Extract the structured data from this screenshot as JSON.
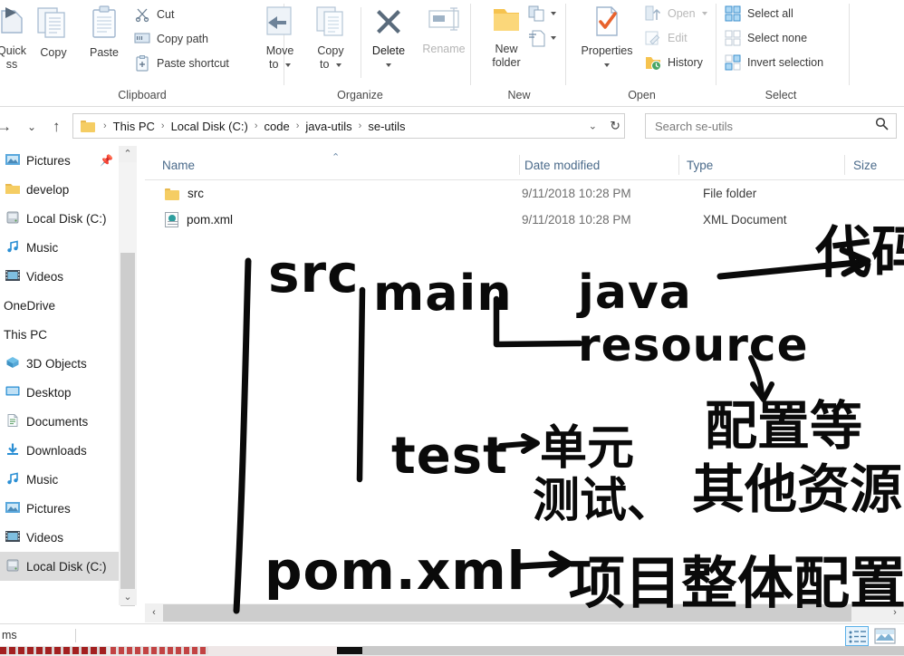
{
  "ribbon": {
    "groups": [
      {
        "label": "Clipboard"
      },
      {
        "label": "Organize"
      },
      {
        "label": "New"
      },
      {
        "label": "Open"
      },
      {
        "label": "Select"
      }
    ],
    "clipboard": {
      "pin_label_line1": "Quick",
      "pin_label_line2": "ss",
      "copy_label": "Copy",
      "paste_label": "Paste",
      "cut_label": "Cut",
      "copy_path_label": "Copy path",
      "paste_shortcut_label": "Paste shortcut"
    },
    "organize": {
      "move_to_line1": "Move",
      "move_to_line2": "to",
      "copy_to_line1": "Copy",
      "copy_to_line2": "to",
      "delete_label": "Delete",
      "rename_label": "Rename"
    },
    "new": {
      "new_folder_line1": "New",
      "new_folder_line2": "folder"
    },
    "open": {
      "properties_label": "Properties",
      "open_label": "Open",
      "edit_label": "Edit",
      "history_label": "History"
    },
    "select": {
      "select_all_label": "Select all",
      "select_none_label": "Select none",
      "invert_selection_label": "Invert selection"
    }
  },
  "addressbar": {
    "breadcrumbs": [
      "This PC",
      "Local Disk (C:)",
      "code",
      "java-utils",
      "se-utils"
    ],
    "separator": "›",
    "up_icon": "↑",
    "forward_icon": "→",
    "recent_icon": "⌄",
    "refresh_icon": "↻",
    "dropdown_icon": "⌄"
  },
  "search": {
    "placeholder": "Search se-utils",
    "value": "",
    "icon": "search-icon"
  },
  "sidebar": {
    "items": [
      {
        "label": "Pictures",
        "icon": "pictures-icon",
        "pinned": true,
        "indent": 1,
        "selected": false
      },
      {
        "label": "develop",
        "icon": "folder-icon",
        "pinned": false,
        "indent": 1,
        "selected": false
      },
      {
        "label": "Local Disk (C:)",
        "icon": "drive-icon",
        "pinned": false,
        "indent": 1,
        "selected": false
      },
      {
        "label": "Music",
        "icon": "music-icon",
        "pinned": false,
        "indent": 1,
        "selected": false
      },
      {
        "label": "Videos",
        "icon": "videos-icon",
        "pinned": false,
        "indent": 1,
        "selected": false
      },
      {
        "label": "OneDrive",
        "icon": "onedrive-icon",
        "pinned": false,
        "indent": 0,
        "selected": false
      },
      {
        "label": "This PC",
        "icon": "pc-icon",
        "pinned": false,
        "indent": 0,
        "selected": false
      },
      {
        "label": "3D Objects",
        "icon": "objects3d-icon",
        "pinned": false,
        "indent": 1,
        "selected": false
      },
      {
        "label": "Desktop",
        "icon": "desktop-icon",
        "pinned": false,
        "indent": 1,
        "selected": false
      },
      {
        "label": "Documents",
        "icon": "documents-icon",
        "pinned": false,
        "indent": 1,
        "selected": false
      },
      {
        "label": "Downloads",
        "icon": "downloads-icon",
        "pinned": false,
        "indent": 1,
        "selected": false
      },
      {
        "label": "Music",
        "icon": "music-icon",
        "pinned": false,
        "indent": 1,
        "selected": false
      },
      {
        "label": "Pictures",
        "icon": "pictures-icon",
        "pinned": false,
        "indent": 1,
        "selected": false
      },
      {
        "label": "Videos",
        "icon": "videos-icon",
        "pinned": false,
        "indent": 1,
        "selected": false
      },
      {
        "label": "Local Disk (C:)",
        "icon": "drive-icon",
        "pinned": false,
        "indent": 1,
        "selected": true
      }
    ]
  },
  "filelist": {
    "columns": [
      {
        "label": "Name",
        "sorted": "asc"
      },
      {
        "label": "Date modified",
        "sorted": ""
      },
      {
        "label": "Type",
        "sorted": ""
      },
      {
        "label": "Size",
        "sorted": ""
      }
    ],
    "sort_indicator": "⌃",
    "rows": [
      {
        "name": "src",
        "icon": "folder-icon",
        "date": "9/11/2018 10:28 PM",
        "type": "File folder",
        "size": ""
      },
      {
        "name": "pom.xml",
        "icon": "xml-file-icon",
        "date": "9/11/2018 10:28 PM",
        "type": "XML Document",
        "size": ""
      }
    ]
  },
  "statusbar": {
    "text": "ms",
    "view_details_icon": "details-view-icon",
    "view_large_icons_icon": "large-icons-view-icon"
  },
  "scrollbars": {
    "h_left_icon": "‹",
    "h_right_icon": "›",
    "v_up_icon": "⌃",
    "v_down_icon": "⌄"
  },
  "annotations": {
    "ink_color": "#0a0a0a",
    "notes": [
      {
        "id": "src",
        "text": "src"
      },
      {
        "id": "main",
        "text": "main"
      },
      {
        "id": "java",
        "text": "java"
      },
      {
        "id": "java-arrow",
        "text": "→"
      },
      {
        "id": "java-meaning",
        "text": "代码"
      },
      {
        "id": "resource",
        "text": "resource"
      },
      {
        "id": "resource-meaning",
        "text": "配置等"
      },
      {
        "id": "resource-meaning2",
        "text": "其他资源"
      },
      {
        "id": "test",
        "text": "test"
      },
      {
        "id": "test-arrow",
        "text": "→"
      },
      {
        "id": "test-meaning",
        "text": "单元"
      },
      {
        "id": "test-meaning2",
        "text": "测试、"
      },
      {
        "id": "pom",
        "text": "pom.xml"
      },
      {
        "id": "pom-arrow",
        "text": "→"
      },
      {
        "id": "pom-meaning",
        "text": "项目整体配置"
      }
    ]
  }
}
